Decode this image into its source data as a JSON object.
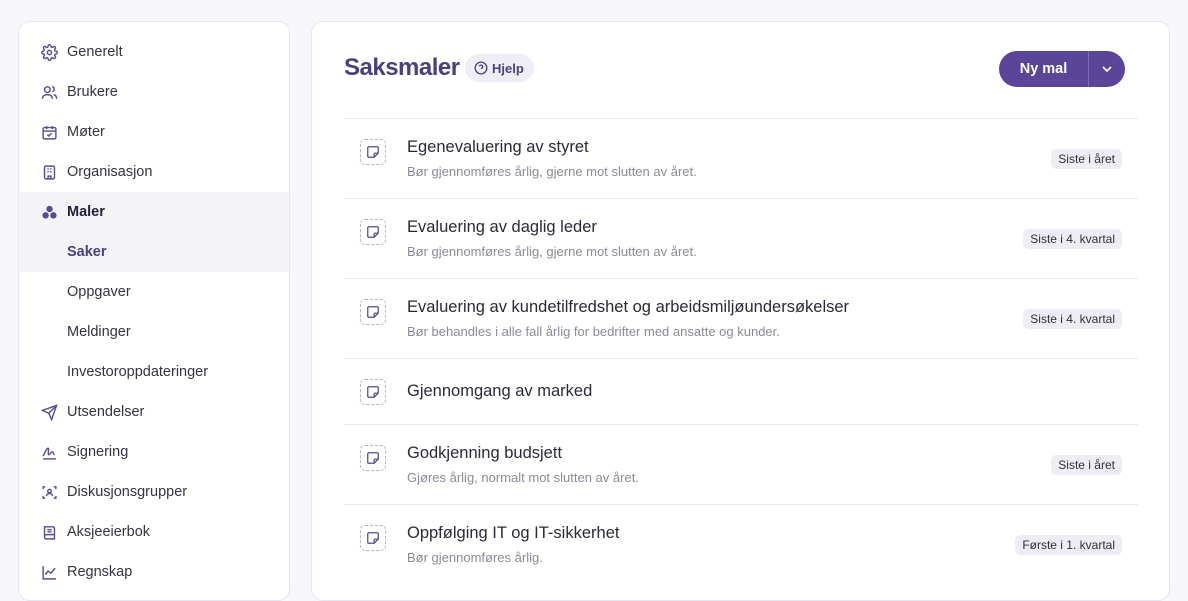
{
  "sidebar": {
    "items": [
      {
        "label": "Generelt",
        "icon": "gear-icon"
      },
      {
        "label": "Brukere",
        "icon": "users-icon"
      },
      {
        "label": "Møter",
        "icon": "calendar-icon"
      },
      {
        "label": "Organisasjon",
        "icon": "building-icon"
      },
      {
        "label": "Maler",
        "icon": "shapes-icon"
      },
      {
        "label": "Saker"
      },
      {
        "label": "Oppgaver"
      },
      {
        "label": "Meldinger"
      },
      {
        "label": "Investoroppdateringer"
      },
      {
        "label": "Utsendelser",
        "icon": "send-icon"
      },
      {
        "label": "Signering",
        "icon": "signature-icon"
      },
      {
        "label": "Diskusjonsgrupper",
        "icon": "group-icon"
      },
      {
        "label": "Aksjeeierbok",
        "icon": "book-icon"
      },
      {
        "label": "Regnskap",
        "icon": "chart-line-icon"
      }
    ]
  },
  "header": {
    "title": "Saksmaler",
    "help_label": "Hjelp",
    "new_label": "Ny mal"
  },
  "templates": [
    {
      "title": "Egenevaluering av styret",
      "desc": "Bør gjennomføres årlig, gjerne mot slutten av året.",
      "badge": "Siste i året"
    },
    {
      "title": "Evaluering av daglig leder",
      "desc": "Bør gjennomføres årlig, gjerne mot slutten av året.",
      "badge": "Siste i 4. kvartal"
    },
    {
      "title": "Evaluering av kundetilfredshet og arbeidsmiljøundersøkelser",
      "desc": "Bør behandles i alle fall årlig for bedrifter med ansatte og kunder.",
      "badge": "Siste i 4. kvartal"
    },
    {
      "title": "Gjennomgang av marked"
    },
    {
      "title": "Godkjenning budsjett",
      "desc": "Gjøres årlig, normalt mot slutten av året.",
      "badge": "Siste i året"
    },
    {
      "title": "Oppfølging IT og IT-sikkerhet",
      "desc": "Bør gjennomføres årlig.",
      "badge": "Første i 1. kvartal"
    }
  ],
  "colors": {
    "accent": "#5a4598",
    "title": "#4b3f7e",
    "background": "#f7f6fb"
  }
}
